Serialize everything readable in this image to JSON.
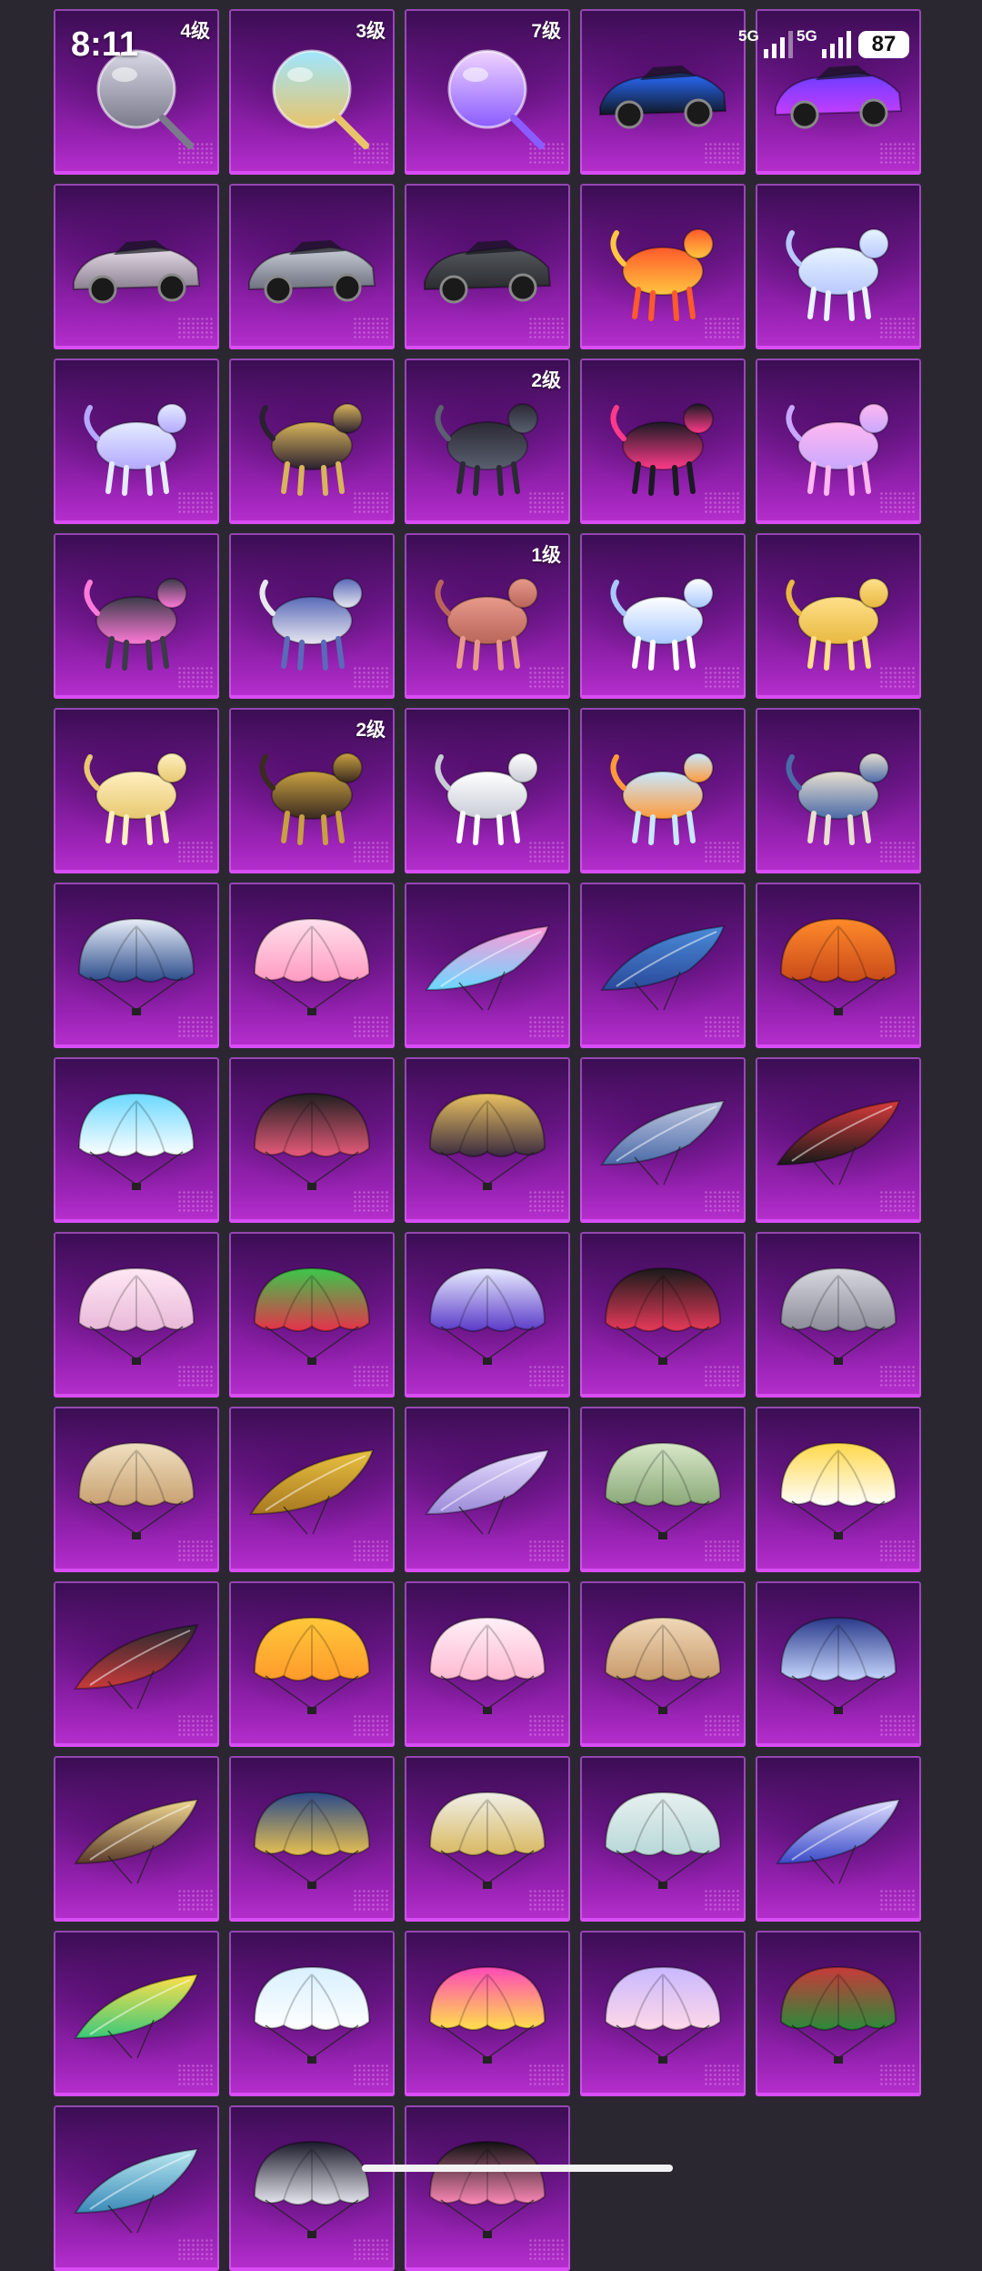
{
  "status_bar": {
    "time": "8:11",
    "signal_1_label": "5G",
    "signal_2_label": "5G",
    "battery_level": "87"
  },
  "inventory": {
    "items": [
      {
        "icon": "rifle-skin-icon",
        "tier": "4级"
      },
      {
        "icon": "magic-mirror-icon",
        "tier": "3级"
      },
      {
        "icon": "potion-bottle-icon",
        "tier": "7级"
      },
      {
        "icon": "race-car-blue-icon",
        "tier": ""
      },
      {
        "icon": "race-car-purple-icon",
        "tier": ""
      },
      {
        "icon": "suv-white-icon",
        "tier": ""
      },
      {
        "icon": "sports-car-silver-icon",
        "tier": ""
      },
      {
        "icon": "sports-car-grey-icon",
        "tier": ""
      },
      {
        "icon": "fire-motorcycle-icon",
        "tier": ""
      },
      {
        "icon": "unicorn-mount-icon",
        "tier": ""
      },
      {
        "icon": "crystal-horse-icon",
        "tier": ""
      },
      {
        "icon": "golden-horse-icon",
        "tier": ""
      },
      {
        "icon": "dark-shards-icon",
        "tier": "2级"
      },
      {
        "icon": "mech-bat-icon",
        "tier": ""
      },
      {
        "icon": "crystal-flower-icon",
        "tier": ""
      },
      {
        "icon": "cat-helmet-pod-icon",
        "tier": ""
      },
      {
        "icon": "dragon-serpent-icon",
        "tier": ""
      },
      {
        "icon": "heart-blob-icon",
        "tier": "1级"
      },
      {
        "icon": "white-cat-icon",
        "tier": ""
      },
      {
        "icon": "golden-feather-icon",
        "tier": ""
      },
      {
        "icon": "glow-trail-icon",
        "tier": ""
      },
      {
        "icon": "golden-dragon-icon",
        "tier": "2级"
      },
      {
        "icon": "white-wings-icon",
        "tier": ""
      },
      {
        "icon": "emote-figure-icon",
        "tier": ""
      },
      {
        "icon": "ornate-glider-icon",
        "tier": ""
      },
      {
        "icon": "tech-parachute-icon",
        "tier": ""
      },
      {
        "icon": "cat-parachute-pink-icon",
        "tier": ""
      },
      {
        "icon": "glider-pink-blue-icon",
        "tier": ""
      },
      {
        "icon": "glider-blue-icon",
        "tier": ""
      },
      {
        "icon": "fire-orb-icon",
        "tier": ""
      },
      {
        "icon": "parachute-sky-icon",
        "tier": ""
      },
      {
        "icon": "parachute-dark-red-icon",
        "tier": ""
      },
      {
        "icon": "parachute-star-gold-icon",
        "tier": ""
      },
      {
        "icon": "glider-silver-icon",
        "tier": ""
      },
      {
        "icon": "glider-red-black-icon",
        "tier": ""
      },
      {
        "icon": "parachute-lace-pink-icon",
        "tier": ""
      },
      {
        "icon": "parachute-joker-icon",
        "tier": ""
      },
      {
        "icon": "parachute-anime-icon",
        "tier": ""
      },
      {
        "icon": "parachute-demon-icon",
        "tier": ""
      },
      {
        "icon": "parachute-diamond-icon",
        "tier": ""
      },
      {
        "icon": "parachute-beige-icon",
        "tier": ""
      },
      {
        "icon": "glider-gold-icon",
        "tier": ""
      },
      {
        "icon": "glider-lavender-icon",
        "tier": ""
      },
      {
        "icon": "parachute-green-cream-icon",
        "tier": ""
      },
      {
        "icon": "parachute-red-panda-icon",
        "tier": ""
      },
      {
        "icon": "glider-dark-red-icon",
        "tier": ""
      },
      {
        "icon": "parachute-duck-icon",
        "tier": ""
      },
      {
        "icon": "parachute-pink-plaid-icon",
        "tier": ""
      },
      {
        "icon": "parachute-cat-face-icon",
        "tier": ""
      },
      {
        "icon": "parachute-navy-icon",
        "tier": ""
      },
      {
        "icon": "glider-stained-glass-icon",
        "tier": ""
      },
      {
        "icon": "parachute-blue-gold-icon",
        "tier": ""
      },
      {
        "icon": "parachute-white-gold-icon",
        "tier": ""
      },
      {
        "icon": "parachute-cartoon-icon",
        "tier": ""
      },
      {
        "icon": "glider-blue-bow-icon",
        "tier": ""
      },
      {
        "icon": "glider-rainbow-icon",
        "tier": ""
      },
      {
        "icon": "parachute-ice-icon",
        "tier": ""
      },
      {
        "icon": "parachute-magenta-icon",
        "tier": ""
      },
      {
        "icon": "parachute-princess-icon",
        "tier": ""
      },
      {
        "icon": "parachute-christmas-icon",
        "tier": ""
      },
      {
        "icon": "glider-teal-icon",
        "tier": ""
      },
      {
        "icon": "parachute-zebra-icon",
        "tier": ""
      },
      {
        "icon": "black-cat-icon",
        "tier": ""
      }
    ]
  }
}
